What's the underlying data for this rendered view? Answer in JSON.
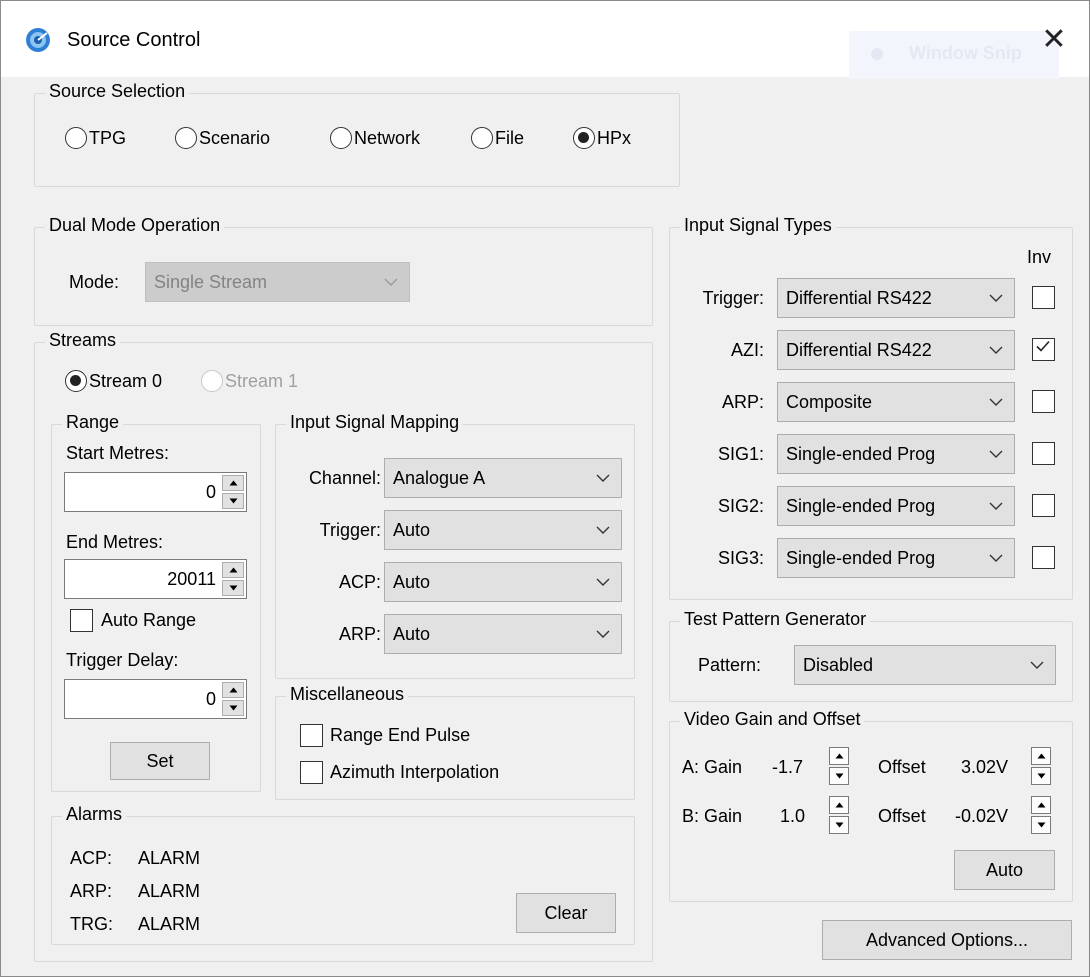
{
  "window": {
    "title": "Source Control",
    "close_glyph": "✕",
    "background_overlay_text": "Window Snip"
  },
  "source_selection": {
    "title": "Source Selection",
    "options": [
      {
        "label": "TPG",
        "checked": false
      },
      {
        "label": "Scenario",
        "checked": false
      },
      {
        "label": "Network",
        "checked": false
      },
      {
        "label": "File",
        "checked": false
      },
      {
        "label": "HPx",
        "checked": true
      }
    ]
  },
  "dual_mode": {
    "title": "Dual Mode Operation",
    "mode_label": "Mode:",
    "mode_value": "Single Stream"
  },
  "streams": {
    "title": "Streams",
    "stream0_label": "Stream 0",
    "stream1_label": "Stream 1",
    "range": {
      "title": "Range",
      "start_label": "Start Metres:",
      "start_value": "0",
      "end_label": "End Metres:",
      "end_value": "20011",
      "auto_range_label": "Auto Range",
      "trigger_delay_label": "Trigger Delay:",
      "trigger_delay_value": "0",
      "set_label": "Set"
    },
    "mapping": {
      "title": "Input Signal Mapping",
      "rows": [
        {
          "label": "Channel:",
          "value": "Analogue A"
        },
        {
          "label": "Trigger:",
          "value": "Auto"
        },
        {
          "label": "ACP:",
          "value": "Auto"
        },
        {
          "label": "ARP:",
          "value": "Auto"
        }
      ]
    },
    "misc": {
      "title": "Miscellaneous",
      "range_end_pulse_label": "Range End Pulse",
      "azimuth_interp_label": "Azimuth Interpolation"
    },
    "alarms": {
      "title": "Alarms",
      "rows": [
        {
          "label": "ACP:",
          "value": "ALARM"
        },
        {
          "label": "ARP:",
          "value": "ALARM"
        },
        {
          "label": "TRG:",
          "value": "ALARM"
        }
      ],
      "clear_label": "Clear"
    }
  },
  "input_signal_types": {
    "title": "Input Signal Types",
    "inv_header": "Inv",
    "rows": [
      {
        "label": "Trigger:",
        "value": "Differential RS422",
        "inv": false
      },
      {
        "label": "AZI:",
        "value": "Differential RS422",
        "inv": true
      },
      {
        "label": "ARP:",
        "value": "Composite",
        "inv": false
      },
      {
        "label": "SIG1:",
        "value": "Single-ended Prog",
        "inv": false
      },
      {
        "label": "SIG2:",
        "value": "Single-ended Prog",
        "inv": false
      },
      {
        "label": "SIG3:",
        "value": "Single-ended Prog",
        "inv": false
      }
    ]
  },
  "tpg": {
    "title": "Test Pattern Generator",
    "pattern_label": "Pattern:",
    "pattern_value": "Disabled"
  },
  "video": {
    "title": "Video Gain and Offset",
    "a_gain_label": "A: Gain",
    "a_gain_value": "-1.7",
    "a_offset_label": "Offset",
    "a_offset_value": "3.02V",
    "b_gain_label": "B: Gain",
    "b_gain_value": "1.0",
    "b_offset_label": "Offset",
    "b_offset_value": "-0.02V",
    "auto_label": "Auto"
  },
  "advanced_label": "Advanced Options..."
}
